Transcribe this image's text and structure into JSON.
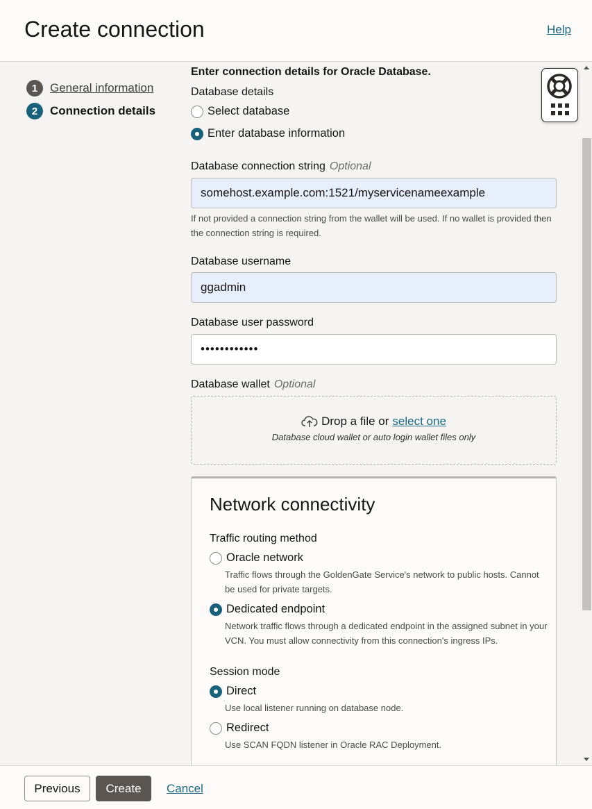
{
  "header": {
    "title": "Create connection",
    "help": "Help"
  },
  "steps": [
    {
      "num": "1",
      "label": "General information"
    },
    {
      "num": "2",
      "label": "Connection details"
    }
  ],
  "form": {
    "intro": "Enter connection details for Oracle Database.",
    "db_details_label": "Database details",
    "db_options": [
      {
        "label": "Select database",
        "selected": false
      },
      {
        "label": "Enter database information",
        "selected": true
      }
    ],
    "conn_string": {
      "label": "Database connection string",
      "optional": "Optional",
      "value": "somehost.example.com:1521/myservicenameexample",
      "hint": "If not provided a connection string from the wallet will be used. If no wallet is provided then the connection string is required."
    },
    "username": {
      "label": "Database username",
      "value": "ggadmin"
    },
    "password": {
      "label": "Database user password",
      "value": "••••••••••••"
    },
    "wallet": {
      "label": "Database wallet",
      "optional": "Optional",
      "drop_text": "Drop a file or",
      "select_link": "select one",
      "drop_hint": "Database cloud wallet or auto login wallet files only"
    },
    "network": {
      "title": "Network connectivity",
      "routing_label": "Traffic routing method",
      "routing_options": [
        {
          "label": "Oracle network",
          "selected": false,
          "hint": "Traffic flows through the GoldenGate Service's network to public hosts. Cannot be used for private targets."
        },
        {
          "label": "Dedicated endpoint",
          "selected": true,
          "hint": "Network traffic flows through a dedicated endpoint in the assigned subnet in your VCN. You must allow connectivity from this connection's ingress IPs."
        }
      ],
      "session_label": "Session mode",
      "session_options": [
        {
          "label": "Direct",
          "selected": true,
          "hint": "Use local listener running on database node."
        },
        {
          "label": "Redirect",
          "selected": false,
          "hint": "Use SCAN FQDN listener in Oracle RAC Deployment."
        }
      ]
    }
  },
  "footer": {
    "previous": "Previous",
    "create": "Create",
    "cancel": "Cancel"
  },
  "colors": {
    "accent": "#19607a",
    "link": "#1c6882",
    "primary_button": "#5b5652",
    "filled_input": "#e8effc"
  },
  "icons": {
    "upload": "cloud-upload-icon",
    "help_widget": "lifebuoy-icon",
    "apps": "grid-icon"
  }
}
